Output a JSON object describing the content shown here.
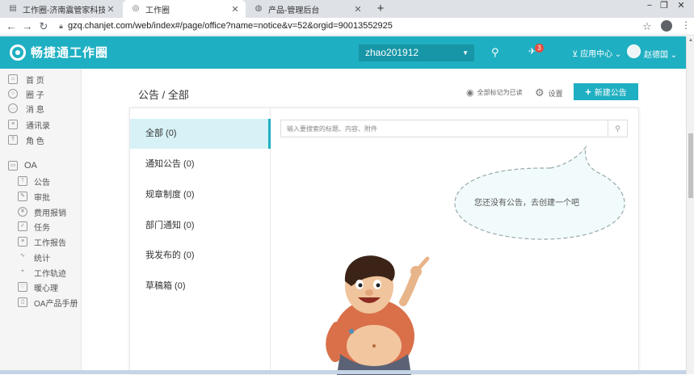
{
  "browser": {
    "tabs": [
      {
        "title": "工作圈-济南震管家科技有限公司",
        "icon": "page-icon"
      },
      {
        "title": "工作圈",
        "icon": "spinner-icon"
      },
      {
        "title": "产品-管理后台",
        "icon": "globe-icon"
      }
    ],
    "url": "gzq.chanjet.com/web/index#/page/office?name=notice&v=52&orgid=90013552925"
  },
  "header": {
    "logo_text": "畅捷通工作圈",
    "company": "zhao201912",
    "notification_count": "3",
    "app_center": "应用中心",
    "user_name": "赵德国"
  },
  "sidebar": {
    "items": [
      {
        "label": "首 页",
        "icon": "home-icon"
      },
      {
        "label": "圈 子",
        "icon": "circle-icon"
      },
      {
        "label": "消 息",
        "icon": "message-icon"
      },
      {
        "label": "通讯录",
        "icon": "contacts-icon"
      },
      {
        "label": "角 色",
        "icon": "shirt-icon"
      }
    ],
    "oa_label": "OA",
    "oa_items": [
      {
        "label": "公告",
        "icon": "notice-icon"
      },
      {
        "label": "审批",
        "icon": "approval-icon"
      },
      {
        "label": "费用报销",
        "icon": "expense-icon"
      },
      {
        "label": "任务",
        "icon": "task-icon"
      },
      {
        "label": "工作报告",
        "icon": "report-icon"
      },
      {
        "label": "统计",
        "icon": "chart-icon"
      },
      {
        "label": "工作轨迹",
        "icon": "track-icon"
      },
      {
        "label": "暖心理",
        "icon": "heart-icon"
      },
      {
        "label": "OA产品手册",
        "icon": "manual-icon"
      }
    ]
  },
  "main": {
    "title": "公告 / 全部",
    "mark_all_read": "全部标记为已读",
    "settings": "设置",
    "new_button": "新建公告",
    "categories": [
      {
        "label": "全部 (0)"
      },
      {
        "label": "通知公告 (0)"
      },
      {
        "label": "规章制度 (0)"
      },
      {
        "label": "部门通知 (0)"
      },
      {
        "label": "我发布的 (0)"
      },
      {
        "label": "草稿箱 (0)"
      }
    ],
    "search_placeholder": "输入要搜索的标题、内容、附件",
    "empty_message": "您还没有公告，去创建一个吧"
  },
  "colors": {
    "accent": "#1fafc2",
    "badge": "#e74c3c"
  }
}
